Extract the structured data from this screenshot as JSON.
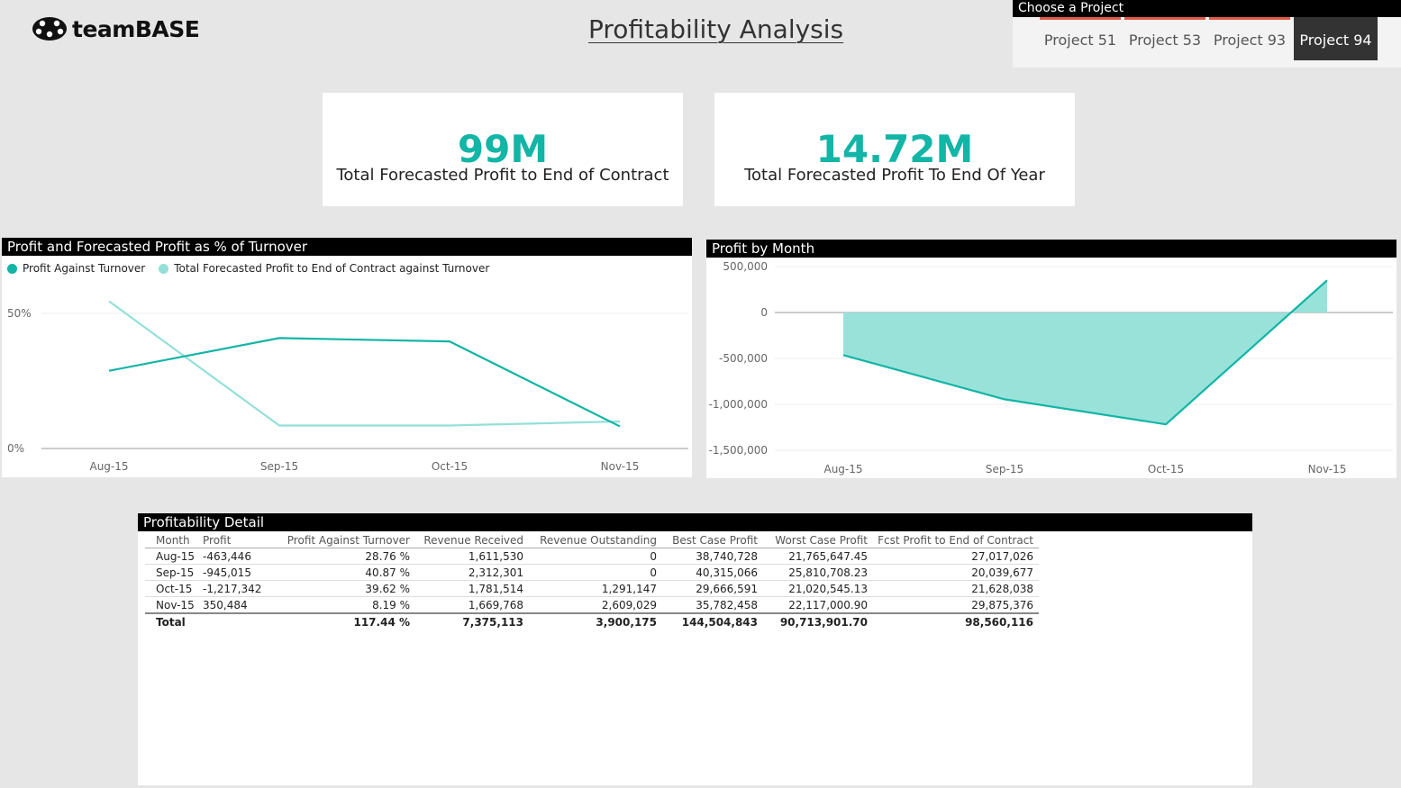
{
  "app": {
    "logo_text": "teamBASE",
    "title": "Profitability Analysis"
  },
  "slicer": {
    "title": "Choose a Project",
    "options": [
      "Project 51",
      "Project 53",
      "Project 93",
      "Project 94"
    ],
    "selected": "Project 94"
  },
  "cards": [
    {
      "value": "99M",
      "label": "Total Forecasted Profit to End of Contract"
    },
    {
      "value": "14.72M",
      "label": "Total Forecasted Profit To End Of Year"
    }
  ],
  "colors": {
    "accent": "#12b5a6",
    "accent_light": "#94e0d8",
    "area_fill": "#99e2da",
    "slicer_underline": "#e05b4b"
  },
  "chart_data": [
    {
      "type": "line",
      "title": "Profit and Forecasted Profit as % of Turnover",
      "categories": [
        "Aug-15",
        "Sep-15",
        "Oct-15",
        "Nov-15"
      ],
      "series": [
        {
          "name": "Profit Against Turnover",
          "values": [
            28.76,
            40.87,
            39.62,
            8.19
          ],
          "color": "#12b5a6"
        },
        {
          "name": "Total Forecasted Profit to End of Contract against Turnover",
          "values": [
            54.5,
            8.5,
            8.5,
            10
          ],
          "color": "#94e0d8"
        }
      ],
      "ylim": [
        0,
        60
      ],
      "yticks": [
        0,
        50
      ],
      "ytick_labels": [
        "0%",
        "50%"
      ],
      "grid": true,
      "legend": "top-left"
    },
    {
      "type": "area",
      "title": "Profit by Month",
      "categories": [
        "Aug-15",
        "Sep-15",
        "Oct-15",
        "Nov-15"
      ],
      "series": [
        {
          "values": [
            -463446,
            -945015,
            -1217342,
            350484
          ],
          "color": "#12b5a6"
        }
      ],
      "ylim": [
        -1500000,
        500000
      ],
      "yticks": [
        500000,
        0,
        -500000,
        -1000000,
        -1500000
      ],
      "ytick_labels": [
        "500,000",
        "0",
        "-500,000",
        "-1,000,000",
        "-1,500,000"
      ],
      "grid": true
    }
  ],
  "table": {
    "title": "Profitability Detail",
    "columns": [
      "Month",
      "Profit",
      "Profit Against Turnover",
      "Revenue Received",
      "Revenue Outstanding",
      "Best Case Profit",
      "Worst Case Profit",
      "Fcst Profit to End of Contract"
    ],
    "rows": [
      [
        "Aug-15",
        "-463,446",
        "28.76 %",
        "1,611,530",
        "0",
        "38,740,728",
        "21,765,647.45",
        "27,017,026"
      ],
      [
        "Sep-15",
        "-945,015",
        "40.87 %",
        "2,312,301",
        "0",
        "40,315,066",
        "25,810,708.23",
        "20,039,677"
      ],
      [
        "Oct-15",
        "-1,217,342",
        "39.62 %",
        "1,781,514",
        "1,291,147",
        "29,666,591",
        "21,020,545.13",
        "21,628,038"
      ],
      [
        "Nov-15",
        "350,484",
        "8.19 %",
        "1,669,768",
        "2,609,029",
        "35,782,458",
        "22,117,000.90",
        "29,875,376"
      ]
    ],
    "total": [
      "Total",
      "",
      "117.44 %",
      "7,375,113",
      "3,900,175",
      "144,504,843",
      "90,713,901.70",
      "98,560,116"
    ]
  }
}
